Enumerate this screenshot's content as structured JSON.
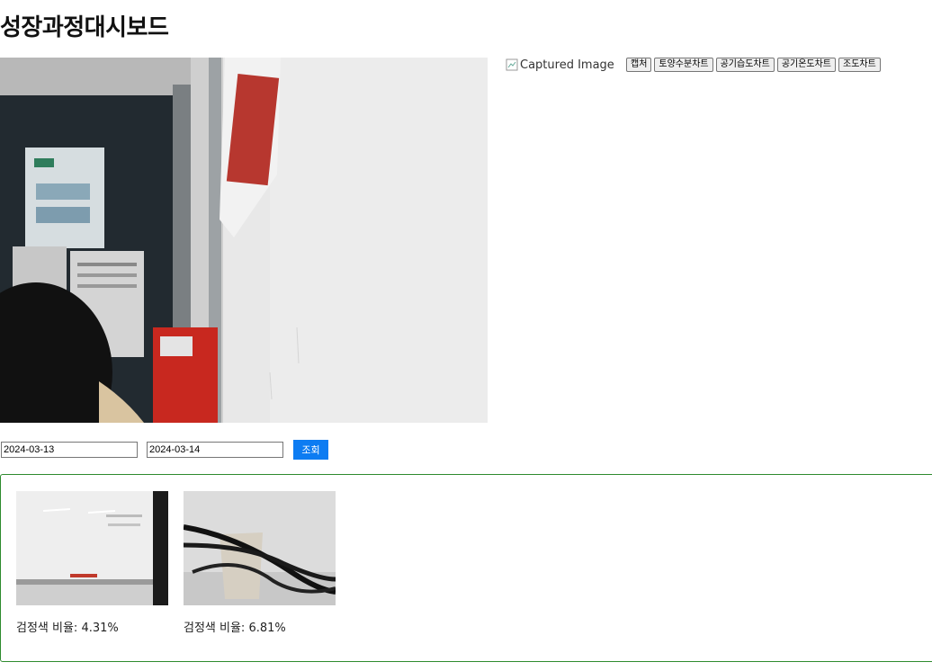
{
  "page": {
    "title": "성장과정대시보드"
  },
  "camera": {
    "captured_alt": "Captured Image"
  },
  "toolbar": {
    "buttons": [
      "캡처",
      "토양수분차트",
      "공기습도차트",
      "공기온도차트",
      "조도차트"
    ]
  },
  "query": {
    "start_date": "2024-03-13",
    "end_date": "2024-03-14",
    "submit_label": "조회"
  },
  "results": [
    {
      "label": "검정색 비율: 4.31%"
    },
    {
      "label": "검정색 비율: 6.81%"
    }
  ],
  "colors": {
    "query_button": "#0d7cf2",
    "results_border": "#2e8b2e"
  }
}
